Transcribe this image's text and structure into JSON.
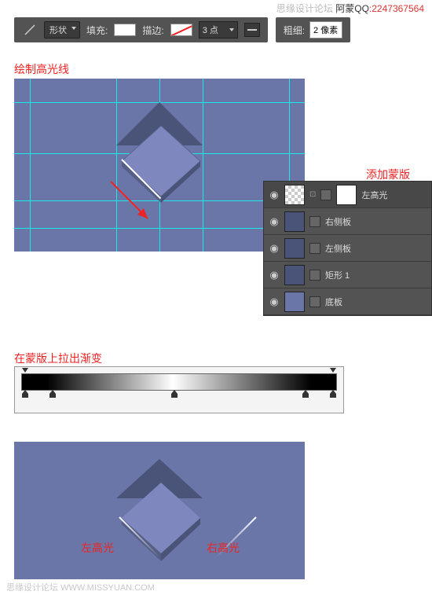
{
  "watermark": {
    "name": "阿蒙",
    "qq_label": "QQ",
    "qq": ":2247367564",
    "site": "思缘设计论坛",
    "url": "WWW.MISSYUAN.COM"
  },
  "toolbar": {
    "shape": "形状",
    "fill_label": "填充:",
    "stroke_label": "描边:",
    "stroke_width": "3 点",
    "thickness_label": "粗细:",
    "thickness_value": "2 像素"
  },
  "annotations": {
    "draw_highlight": "绘制高光线",
    "add_mask": "添加蒙版",
    "gradient_on_mask": "在蒙版上拉出渐变",
    "left_highlight": "左高光",
    "right_highlight": "右高光"
  },
  "layers": [
    {
      "name": "左高光",
      "selected": true,
      "has_mask": true
    },
    {
      "name": "右侧板",
      "selected": false,
      "has_mask": false
    },
    {
      "name": "左侧板",
      "selected": false,
      "has_mask": false
    },
    {
      "name": "矩形 1",
      "selected": false,
      "has_mask": false
    },
    {
      "name": "底板",
      "selected": false,
      "has_mask": false
    }
  ]
}
